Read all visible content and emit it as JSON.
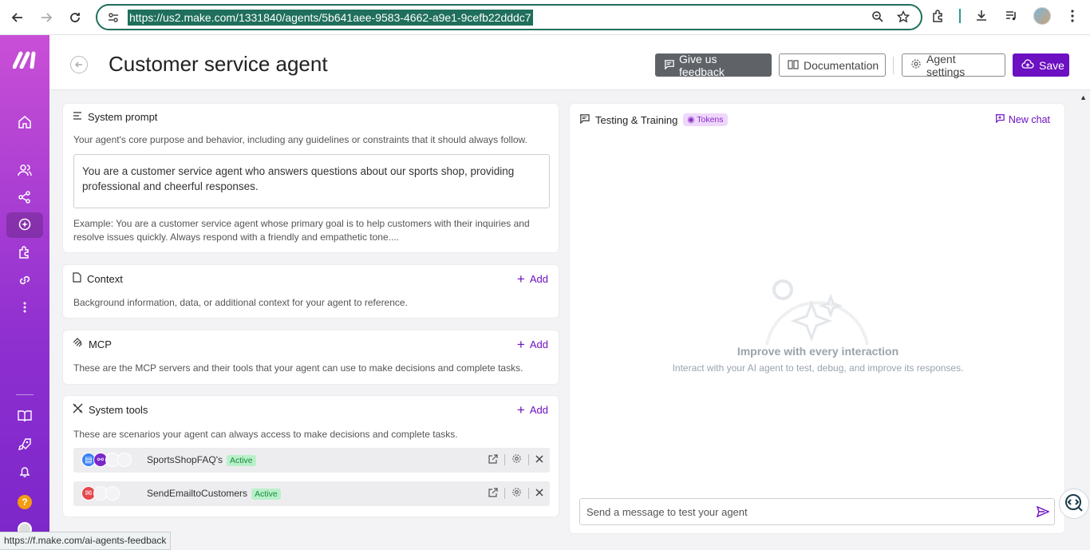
{
  "browser": {
    "url": "https://us2.make.com/1331840/agents/5b641aee-9583-4662-a9e1-9cefb22dddc7",
    "status_url": "https://f.make.com/ai-agents-feedback"
  },
  "sidebar": {
    "logo": "M",
    "items": [
      "home",
      "team",
      "scenarios",
      "ai-agents",
      "apps",
      "connections",
      "more"
    ],
    "bottom": [
      "docs",
      "whats-new",
      "notifications",
      "help",
      "profile"
    ],
    "help_label": "?"
  },
  "header": {
    "title": "Customer service agent",
    "feedback_label": "Give us feedback",
    "documentation_label": "Documentation",
    "settings_label": "Agent settings",
    "save_label": "Save"
  },
  "system_prompt": {
    "title": "System prompt",
    "description": "Your agent's core purpose and behavior, including any guidelines or constraints that it should always follow.",
    "value": "You are a customer service agent who answers questions about our sports shop, providing professional and cheerful responses.",
    "example": "Example: You are a customer service agent whose primary goal is to help customers with their inquiries and resolve issues quickly. Always respond with a friendly and empathetic tone...."
  },
  "context": {
    "title": "Context",
    "add_label": "Add",
    "description": "Background information, data, or additional context for your agent to reference."
  },
  "mcp": {
    "title": "MCP",
    "add_label": "Add",
    "description": "These are the MCP servers and their tools that your agent can use to make decisions and complete tasks."
  },
  "system_tools": {
    "title": "System tools",
    "add_label": "Add",
    "description": "These are scenarios your agent can always access to make decisions and complete tasks.",
    "tools": [
      {
        "name": "SportsShopFAQ's",
        "status": "Active"
      },
      {
        "name": "SendEmailtoCustomers",
        "status": "Active"
      }
    ]
  },
  "chat": {
    "title": "Testing & Training",
    "tokens_label": "Tokens",
    "new_chat_label": "New chat",
    "empty_title": "Improve with every interaction",
    "empty_desc": "Interact with your AI agent to test, debug, and improve its responses.",
    "input_placeholder": "Send a message to test your agent"
  },
  "colors": {
    "brand": "#6c10c2",
    "sidebar_top": "#c94fd6",
    "sidebar_bottom": "#7b26c9",
    "badge_bg": "#b8f0c9"
  }
}
